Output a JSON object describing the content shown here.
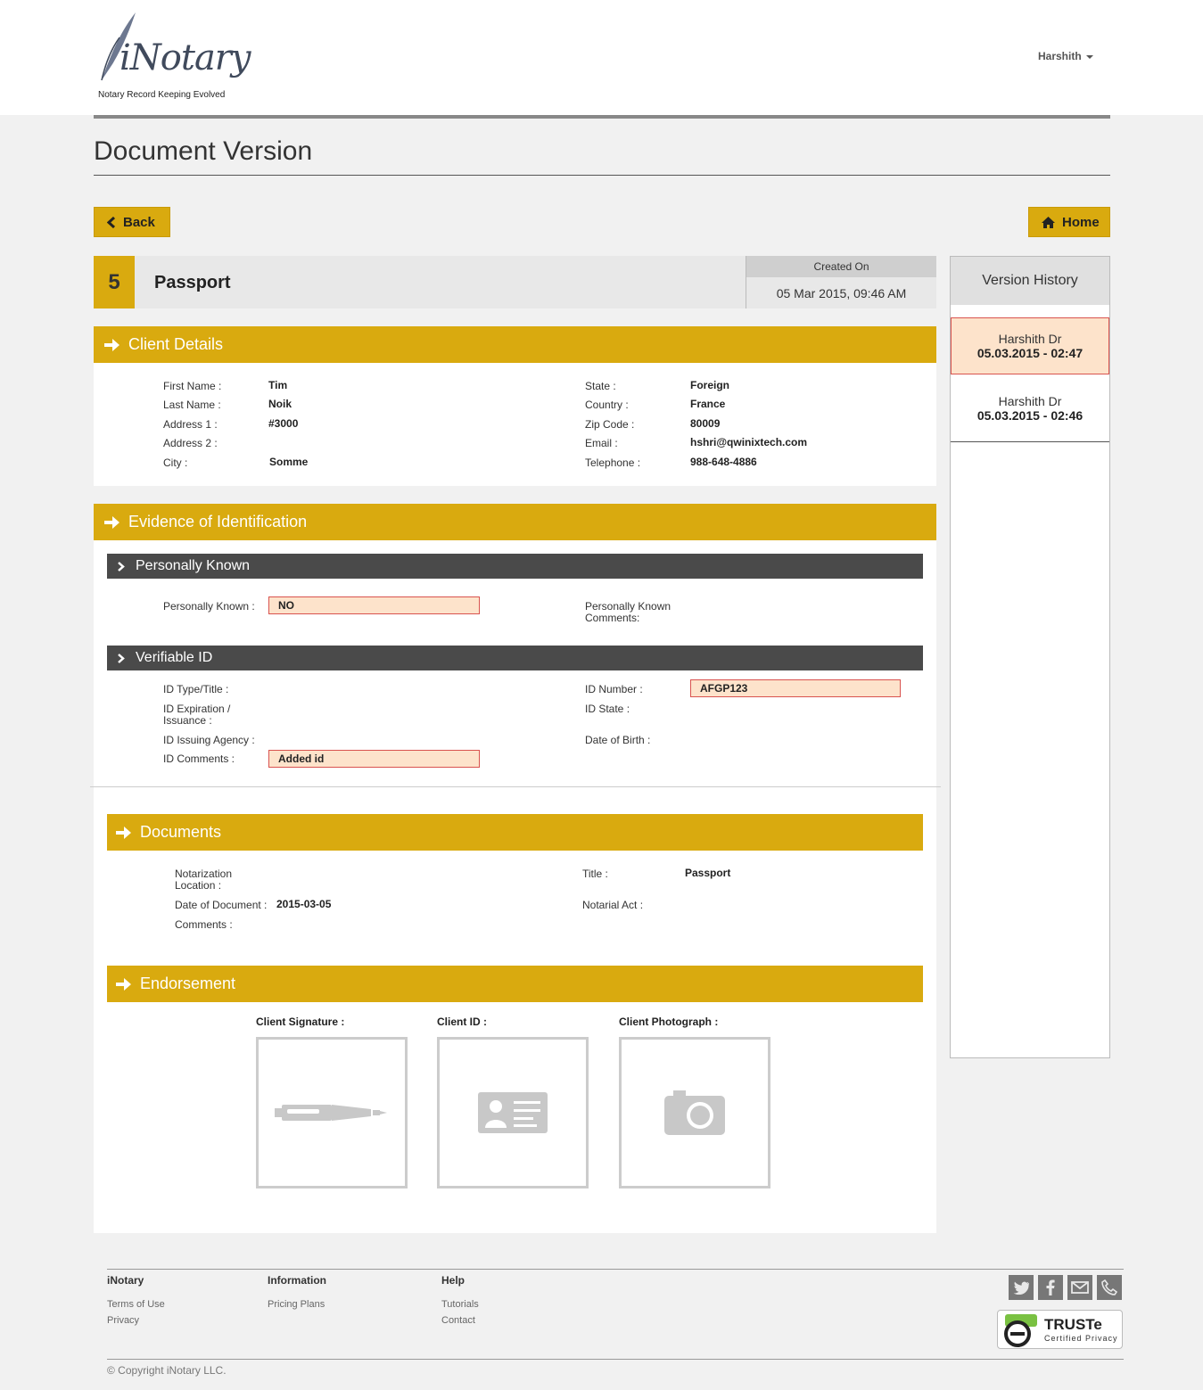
{
  "header": {
    "logo_text": "iNotary",
    "tagline": "Notary Record Keeping Evolved",
    "user_name": "Harshith"
  },
  "page": {
    "title": "Document Version",
    "back_label": "Back",
    "home_label": "Home"
  },
  "document": {
    "number": "5",
    "name": "Passport",
    "created_label": "Created On",
    "created_value": "05 Mar 2015, 09:46 AM"
  },
  "client_details": {
    "title": "Client Details",
    "first_name_label": "First Name :",
    "first_name": "Tim",
    "last_name_label": "Last Name :",
    "last_name": "Noik",
    "address1_label": "Address 1 :",
    "address1": "#3000",
    "address2_label": "Address 2 :",
    "address2": "",
    "city_label": "City :",
    "city": "Somme",
    "state_label": "State :",
    "state": "Foreign",
    "country_label": "Country :",
    "country": "France",
    "zip_label": "Zip Code :",
    "zip": "80009",
    "email_label": "Email :",
    "email": "hshri@qwinixtech.com",
    "telephone_label": "Telephone :",
    "telephone": "988-648-4886"
  },
  "evidence": {
    "title": "Evidence of Identification",
    "personally_known": {
      "title": "Personally Known",
      "known_label": "Personally Known :",
      "known_value": "NO",
      "comments_label_1": "Personally Known",
      "comments_label_2": "Comments:"
    },
    "verifiable_id": {
      "title": "Verifiable ID",
      "id_type_label": "ID Type/Title :",
      "id_exp_label_1": "ID Expiration /",
      "id_exp_label_2": "Issuance :",
      "id_agency_label": "ID Issuing Agency :",
      "id_comments_label": "ID Comments :",
      "id_comments_value": "Added id",
      "id_number_label": "ID Number :",
      "id_number_value": "AFGP123",
      "id_state_label": "ID State :",
      "dob_label": "Date of Birth :"
    }
  },
  "documents": {
    "title": "Documents",
    "location_label_1": "Notarization",
    "location_label_2": "Location :",
    "date_label": "Date of Document :",
    "date_value": "2015-03-05",
    "comments_label": "Comments :",
    "doc_title_label": "Title :",
    "doc_title_value": "Passport",
    "notarial_act_label": "Notarial Act :"
  },
  "endorsement": {
    "title": "Endorsement",
    "signature_label": "Client Signature :",
    "id_label": "Client ID :",
    "photo_label": "Client Photograph :"
  },
  "version_history": {
    "title": "Version History",
    "items": [
      {
        "user": "Harshith Dr",
        "date": "05.03.2015 - 02:47",
        "active": true
      },
      {
        "user": "Harshith Dr",
        "date": "05.03.2015 - 02:46",
        "active": false
      }
    ]
  },
  "footer": {
    "col1_head": "iNotary",
    "terms": "Terms of Use",
    "privacy": "Privacy",
    "col2_head": "Information",
    "pricing": "Pricing Plans",
    "col3_head": "Help",
    "tutorials": "Tutorials",
    "contact": "Contact",
    "truste_title": "TRUSTe",
    "truste_sub": "Certified Privacy",
    "copyright": "© Copyright iNotary LLC."
  },
  "colors": {
    "accent_gold": "#d9aa0f",
    "dark_bar": "#4a4a4a",
    "highlight_bg": "#fde3cb",
    "highlight_border": "#d9534f"
  },
  "icons": [
    "chevron-left-icon",
    "home-icon",
    "arrow-right-icon",
    "chevron-right-icon",
    "pen-icon",
    "id-card-icon",
    "camera-icon",
    "twitter-icon",
    "facebook-icon",
    "email-icon",
    "phone-icon"
  ]
}
